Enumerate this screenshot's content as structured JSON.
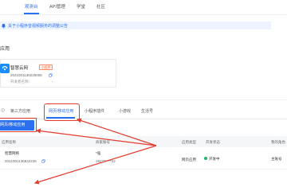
{
  "topnav": {
    "items": [
      {
        "label": "观测台",
        "active": true
      },
      {
        "label": "API管理",
        "active": false
      },
      {
        "label": "学堂",
        "active": false
      },
      {
        "label": "社区",
        "active": false
      }
    ]
  },
  "notice": {
    "icon": "bell-icon",
    "text": "关于小程序音视频服务的调整公告"
  },
  "section_title": "应用",
  "app_card": {
    "name": "智慧云网",
    "badge": "小程序",
    "app_id": "2021001136225006",
    "author": "开发者名称：",
    "chevron": "›"
  },
  "tabs": {
    "items": [
      {
        "label": "第三方应用",
        "active": false
      },
      {
        "label": "网页/移动应用",
        "active": true
      },
      {
        "label": "小程序插件",
        "active": false
      },
      {
        "label": "小游戏",
        "active": false
      },
      {
        "label": "生活号",
        "active": false
      }
    ]
  },
  "create_button": {
    "label": "网页/移动应用"
  },
  "table": {
    "headers": [
      "应用名称",
      "商家账号",
      "应用类型",
      "开发状态",
      "我的角色"
    ],
    "rows": [
      {
        "name": "智慧网络",
        "app_id": "2021001136842235",
        "merchant": "*强",
        "merchant_account": "192*******22",
        "type": "网页应用",
        "status": "开发中",
        "role": "主账号"
      }
    ]
  },
  "colors": {
    "accent": "#2a6ff0",
    "highlight_red": "#e33b2e",
    "status_green": "#1bb56b",
    "badge_orange": "#ff6a3d"
  }
}
